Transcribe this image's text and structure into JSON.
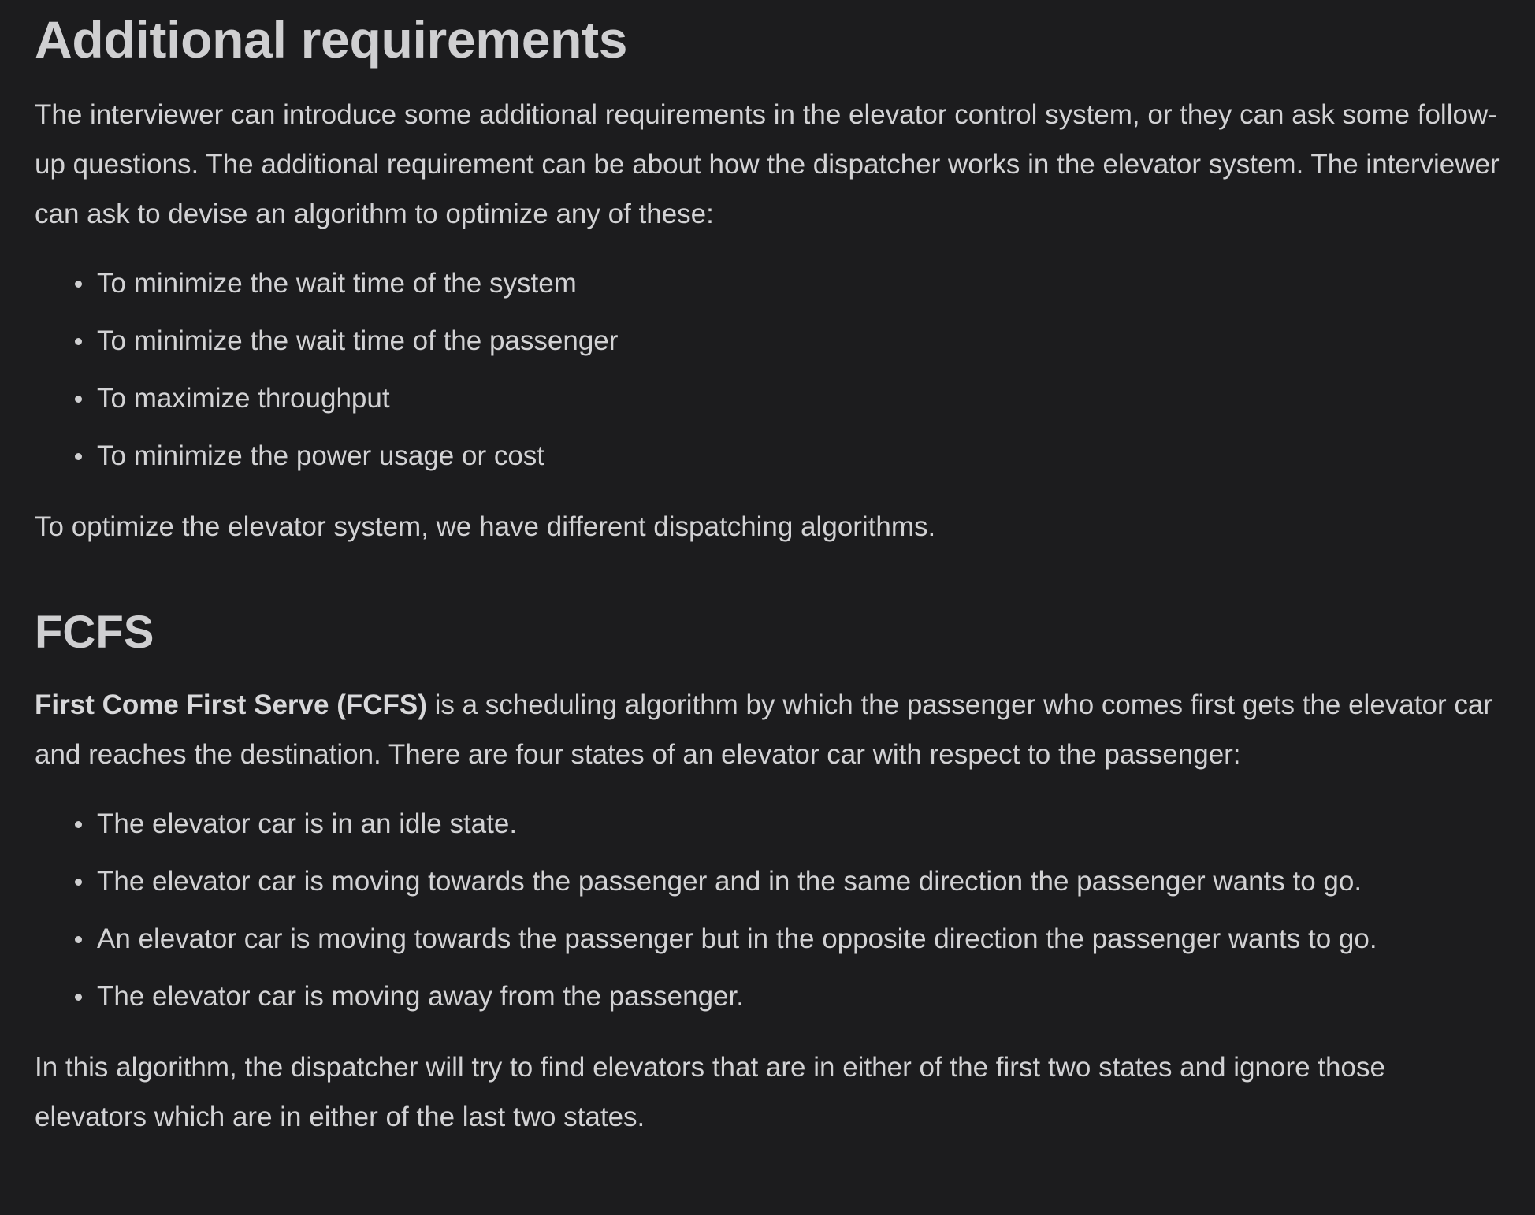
{
  "section1": {
    "heading": "Additional requirements",
    "intro": "The interviewer can introduce some additional requirements in the elevator control system, or they can ask some follow-up questions. The additional requirement can be about how the dispatcher works in the elevator system. The interviewer can ask to devise an algorithm to optimize any of these:",
    "items": [
      "To minimize the wait time of the system",
      "To minimize the wait time of the passenger",
      "To maximize throughput",
      "To minimize the power usage or cost"
    ],
    "closing": "To optimize the elevator system, we have different dispatching algorithms."
  },
  "section2": {
    "heading": "FCFS",
    "intro_bold": "First Come First Serve (FCFS)",
    "intro_rest": " is a scheduling algorithm by which the passenger who comes first gets the elevator car and reaches the destination. There are four states of an elevator car with respect to the passenger:",
    "items": [
      "The elevator car is in an idle state.",
      "The elevator car is moving towards the passenger and in the same direction the passenger wants to go.",
      "An elevator car is moving towards the passenger but in the opposite direction the passenger wants to go.",
      "The elevator car is moving away from the passenger."
    ],
    "closing": "In this algorithm, the dispatcher will try to find elevators that are in either of the first two states and ignore those elevators which are in either of the last two states."
  }
}
